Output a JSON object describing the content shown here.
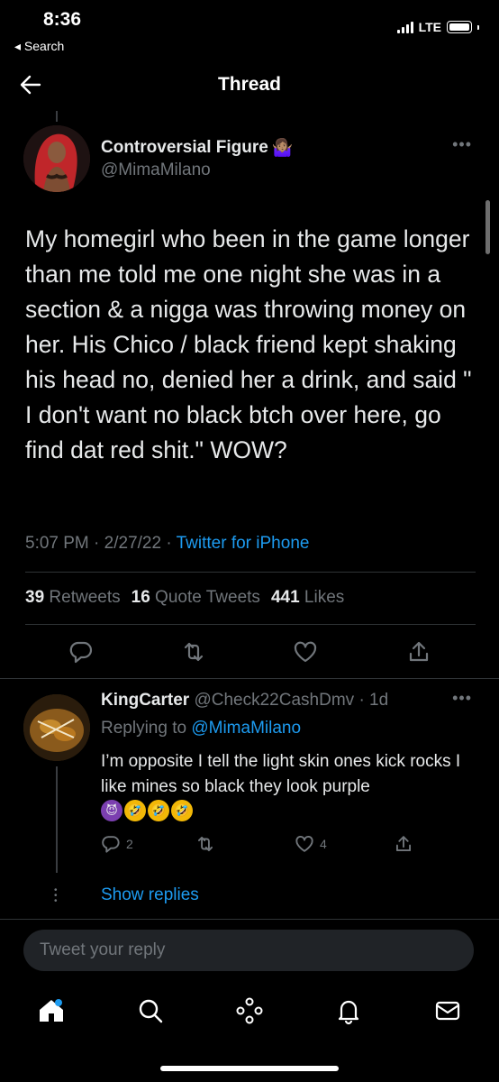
{
  "status_bar": {
    "time": "8:36",
    "back_label": "◂ Search",
    "network": "LTE"
  },
  "nav": {
    "title": "Thread",
    "back_icon": "arrow-left-icon"
  },
  "tweet": {
    "author_name": "Controversial Figure",
    "author_emoji": "🤷🏽‍♀️",
    "author_handle": "@MimaMilano",
    "text": "My homegirl who been in the game longer than me told me one night she was in a section & a nigga was throwing money on her. His Chico / black friend kept shaking his head no, denied her a drink, and said \" I don't want no black btch over here, go find dat red shit.\" WOW?",
    "time": "5:07 PM",
    "date": "2/27/22",
    "separator": "·",
    "source": "Twitter for iPhone",
    "stats": {
      "retweets_count": "39",
      "retweets_label": "Retweets",
      "quotes_count": "16",
      "quotes_label": "Quote Tweets",
      "likes_count": "441",
      "likes_label": "Likes"
    }
  },
  "reply": {
    "author_name": "KingCarter",
    "author_handle": "@Check22CashDmv",
    "separator": "·",
    "age": "1d",
    "replying_prefix": "Replying to",
    "replying_to": "@MimaMilano",
    "text": "I’m opposite I tell the light skin ones kick rocks I like mines so black they look purple",
    "emojis": [
      "😈",
      "🤣",
      "🤣",
      "🤣"
    ],
    "reply_count": "2",
    "like_count": "4",
    "show_replies": "Show replies"
  },
  "composer": {
    "placeholder": "Tweet your reply"
  },
  "colors": {
    "background": "#000000",
    "text": "#e7e9ea",
    "secondary": "#71767b",
    "accent": "#1d9bf0",
    "divider": "#2f3336"
  },
  "icons": [
    "home-icon",
    "search-icon",
    "spaces-icon",
    "bell-icon",
    "mail-icon"
  ]
}
